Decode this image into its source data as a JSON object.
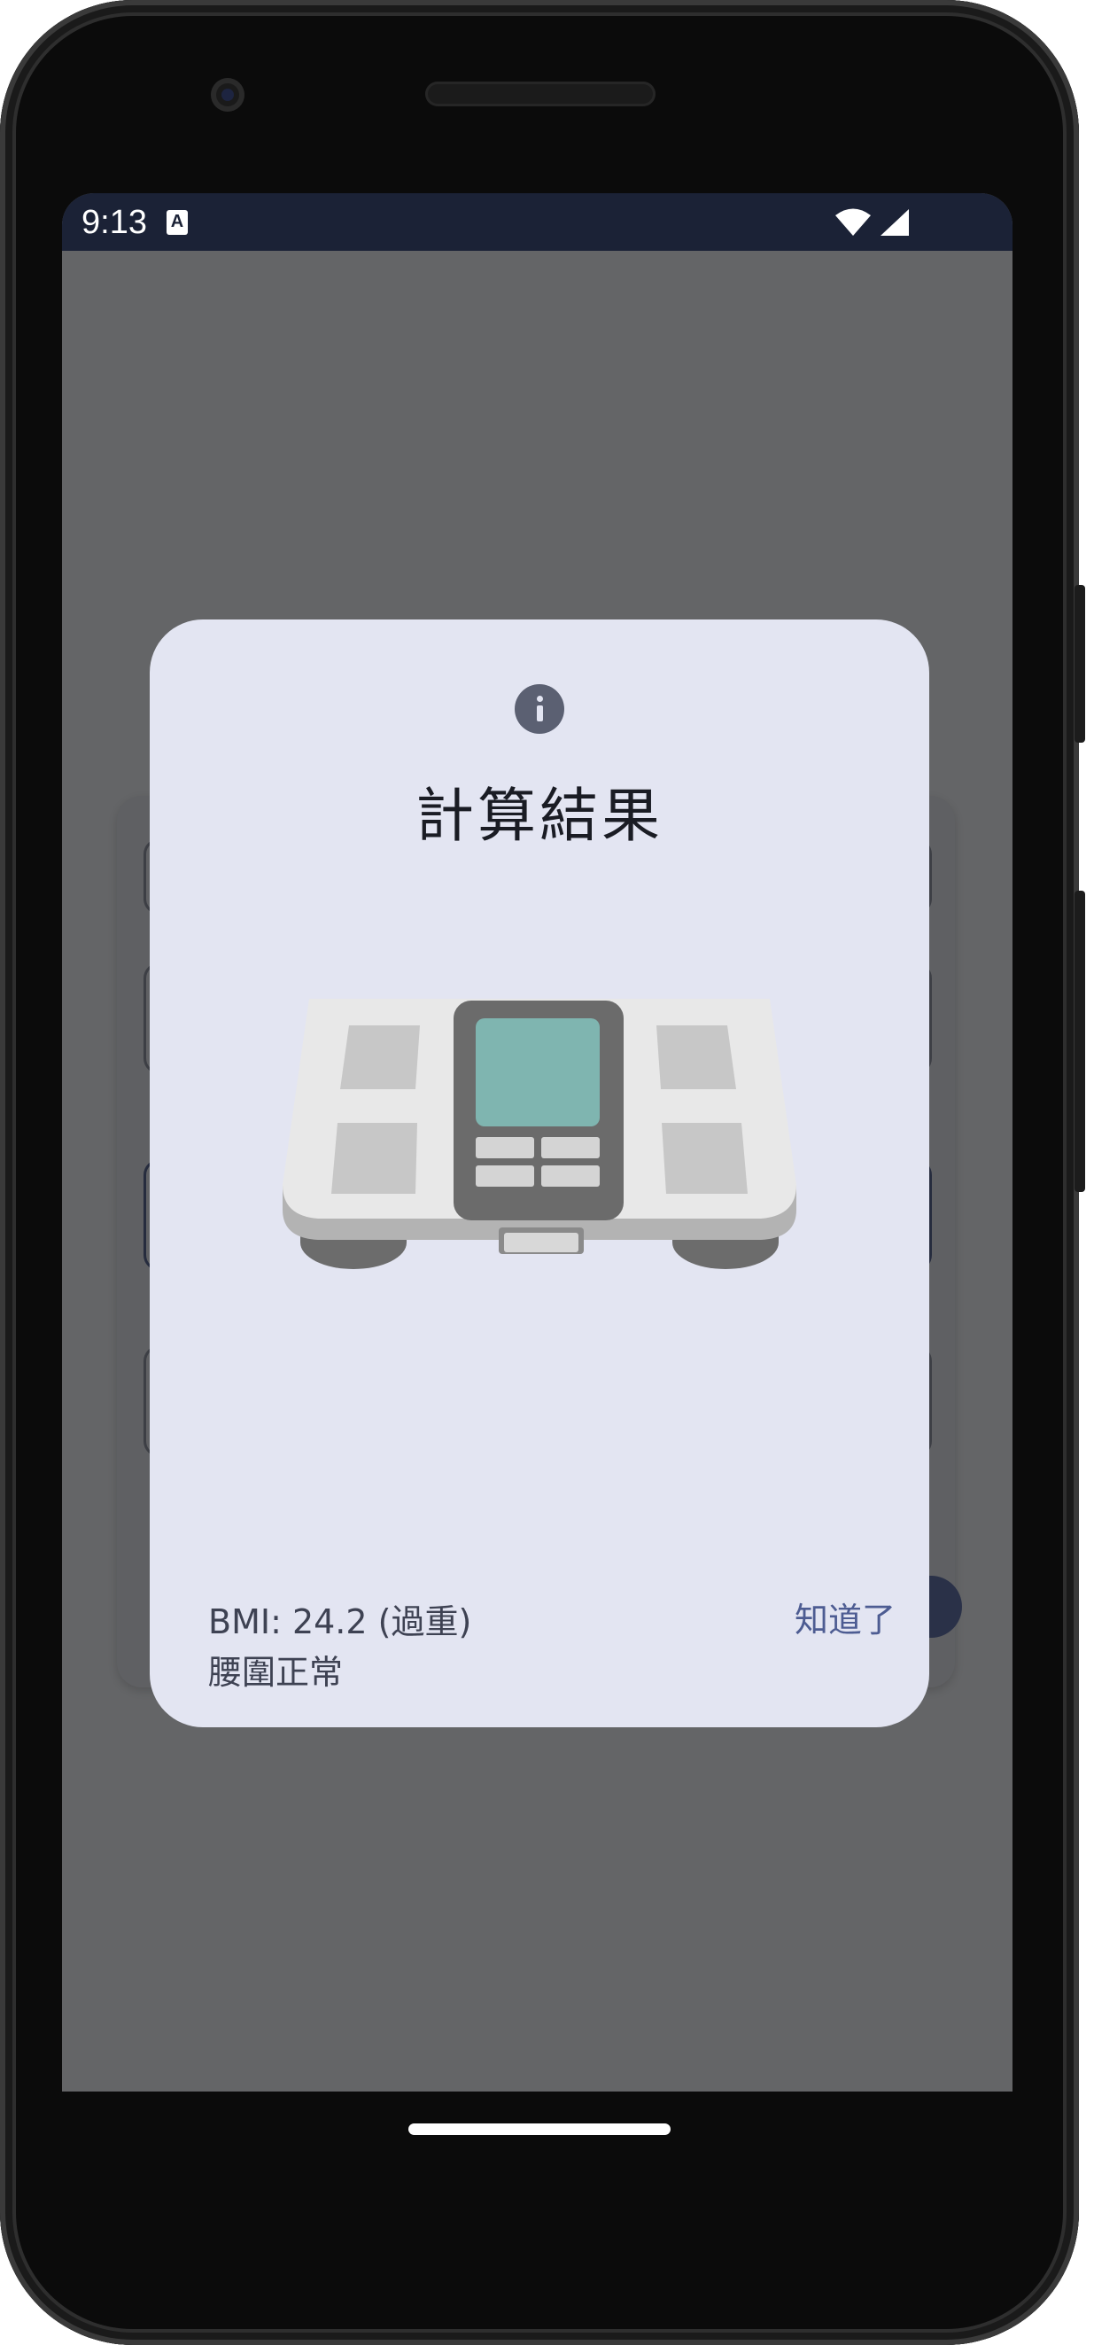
{
  "status_bar": {
    "time": "9:13",
    "notification_icon": "a-box-icon",
    "wifi_icon": "wifi-icon",
    "signal_icon": "signal-icon"
  },
  "dialog": {
    "icon": "info-icon",
    "title": "計算結果",
    "image": "body-composition-scale",
    "bmi_text": "BMI: 24.2 (過重)",
    "waist_text": "腰圍正常",
    "confirm_label": "知道了"
  },
  "colors": {
    "status_bar_bg": "#1b2236",
    "scrim": "#646567",
    "dialog_bg": "#e3e5f2",
    "accent": "#4d5c92",
    "icon": "#5b6072",
    "scale_display": "#7fb5b0"
  }
}
